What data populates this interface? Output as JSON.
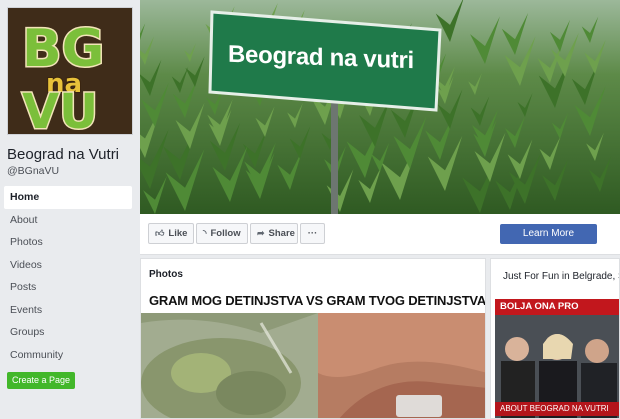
{
  "page": {
    "name": "Beograd na Vutri",
    "handle": "@BGnaVU",
    "logo_text": "BGnaVU"
  },
  "sidebar": {
    "items": [
      {
        "label": "Home",
        "active": true
      },
      {
        "label": "About"
      },
      {
        "label": "Photos"
      },
      {
        "label": "Videos"
      },
      {
        "label": "Posts"
      },
      {
        "label": "Events"
      },
      {
        "label": "Groups"
      },
      {
        "label": "Community"
      }
    ],
    "create_page_label": "Create a Page"
  },
  "cover": {
    "sign_text": "Beograd na vutri"
  },
  "actions": {
    "like": "Like",
    "follow": "Follow",
    "share": "Share",
    "more": "···",
    "learn_more": "Learn More"
  },
  "photos": {
    "title": "Photos",
    "headline": "GRAM MOG DETINJSTVA VS GRAM TVOG DETINJSTVA"
  },
  "right_panel": {
    "text": "Just For Fun in Belgrade, S",
    "banner_top": "BOLJA ONA PRO",
    "banner_bottom": "ABOUT BEOGRAD NA VUTRI"
  },
  "colors": {
    "facebook_blue": "#4267b2",
    "create_green": "#42b72a",
    "sign_green": "#1f7a4a",
    "banner_red": "#c2171d"
  },
  "icons": {
    "like": "thumbs-up-icon",
    "follow": "rss-icon",
    "share": "share-arrow-icon",
    "more": "more-dots-icon"
  }
}
